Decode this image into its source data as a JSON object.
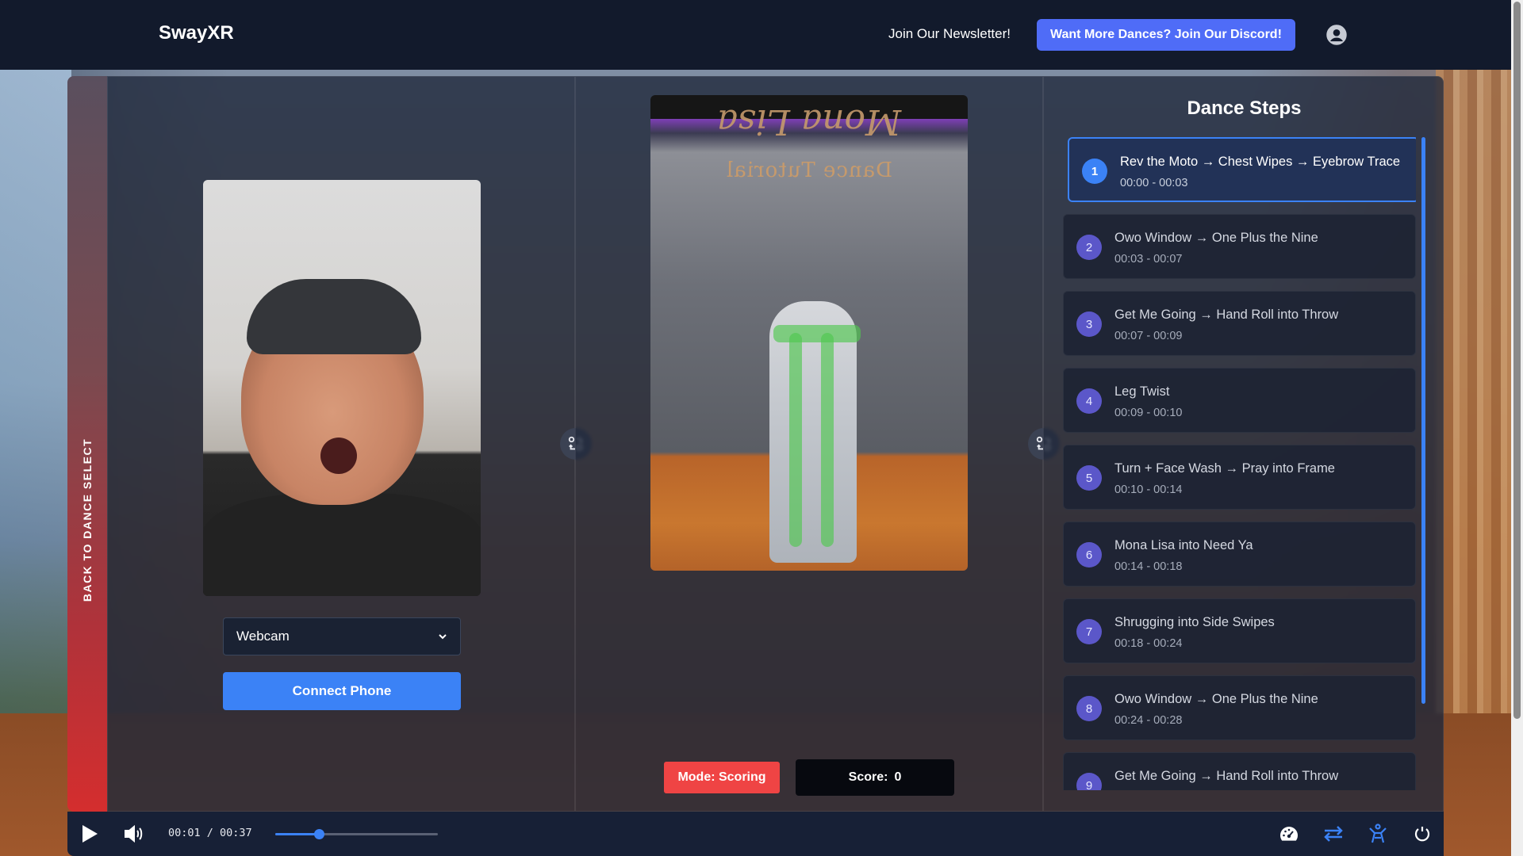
{
  "header": {
    "brand": "SwayXR",
    "newsletter_link": "Join Our Newsletter!",
    "discord_button": "Want More Dances? Join Our Discord!",
    "account_icon": "account-circle-icon"
  },
  "sidebar": {
    "back_label": "BACK TO DANCE SELECT"
  },
  "left_panel": {
    "source_select": {
      "selected": "Webcam",
      "options": [
        "Webcam"
      ]
    },
    "connect_button": "Connect Phone",
    "swap_icon": "swap-icon"
  },
  "middle_panel": {
    "video_title_script": "Mona Lisa",
    "video_title_sub": "Dance Tutorial",
    "mode_badge": "Mode: Scoring",
    "score_label": "Score:",
    "score_value": "0",
    "swap_icon": "swap-icon"
  },
  "steps_panel": {
    "title": "Dance Steps",
    "active_index": 0,
    "steps": [
      {
        "num": "1",
        "name": "Rev the Moto → Chest Wipes → Eyebrow Trace",
        "time": "00:00 - 00:03"
      },
      {
        "num": "2",
        "name": "Owo Window → One Plus the Nine",
        "time": "00:03 - 00:07"
      },
      {
        "num": "3",
        "name": "Get Me Going → Hand Roll into Throw",
        "time": "00:07 - 00:09"
      },
      {
        "num": "4",
        "name": "Leg Twist",
        "time": "00:09 - 00:10"
      },
      {
        "num": "5",
        "name": "Turn + Face Wash → Pray into Frame",
        "time": "00:10 - 00:14"
      },
      {
        "num": "6",
        "name": "Mona Lisa into Need Ya",
        "time": "00:14 - 00:18"
      },
      {
        "num": "7",
        "name": "Shrugging into Side Swipes",
        "time": "00:18 - 00:24"
      },
      {
        "num": "8",
        "name": "Owo Window → One Plus the Nine",
        "time": "00:24 - 00:28"
      },
      {
        "num": "9",
        "name": "Get Me Going → Hand Roll into Throw",
        "time": ""
      }
    ]
  },
  "player": {
    "current_time": "00:01",
    "duration": "00:37",
    "timecode": "00:01 / 00:37",
    "progress_fraction": 0.27,
    "icons": [
      "play-icon",
      "volume-icon",
      "speed-gauge-icon",
      "repeat-icon",
      "pose-skeleton-icon",
      "reset-icon"
    ],
    "accent_color": "#3b82f6"
  },
  "colors": {
    "header_bg": "#121a2c",
    "discord_button": "#4f6cf7",
    "mode_badge": "#ef4444",
    "accent": "#3b82f6",
    "back_strip_red": "#d42e2e"
  }
}
